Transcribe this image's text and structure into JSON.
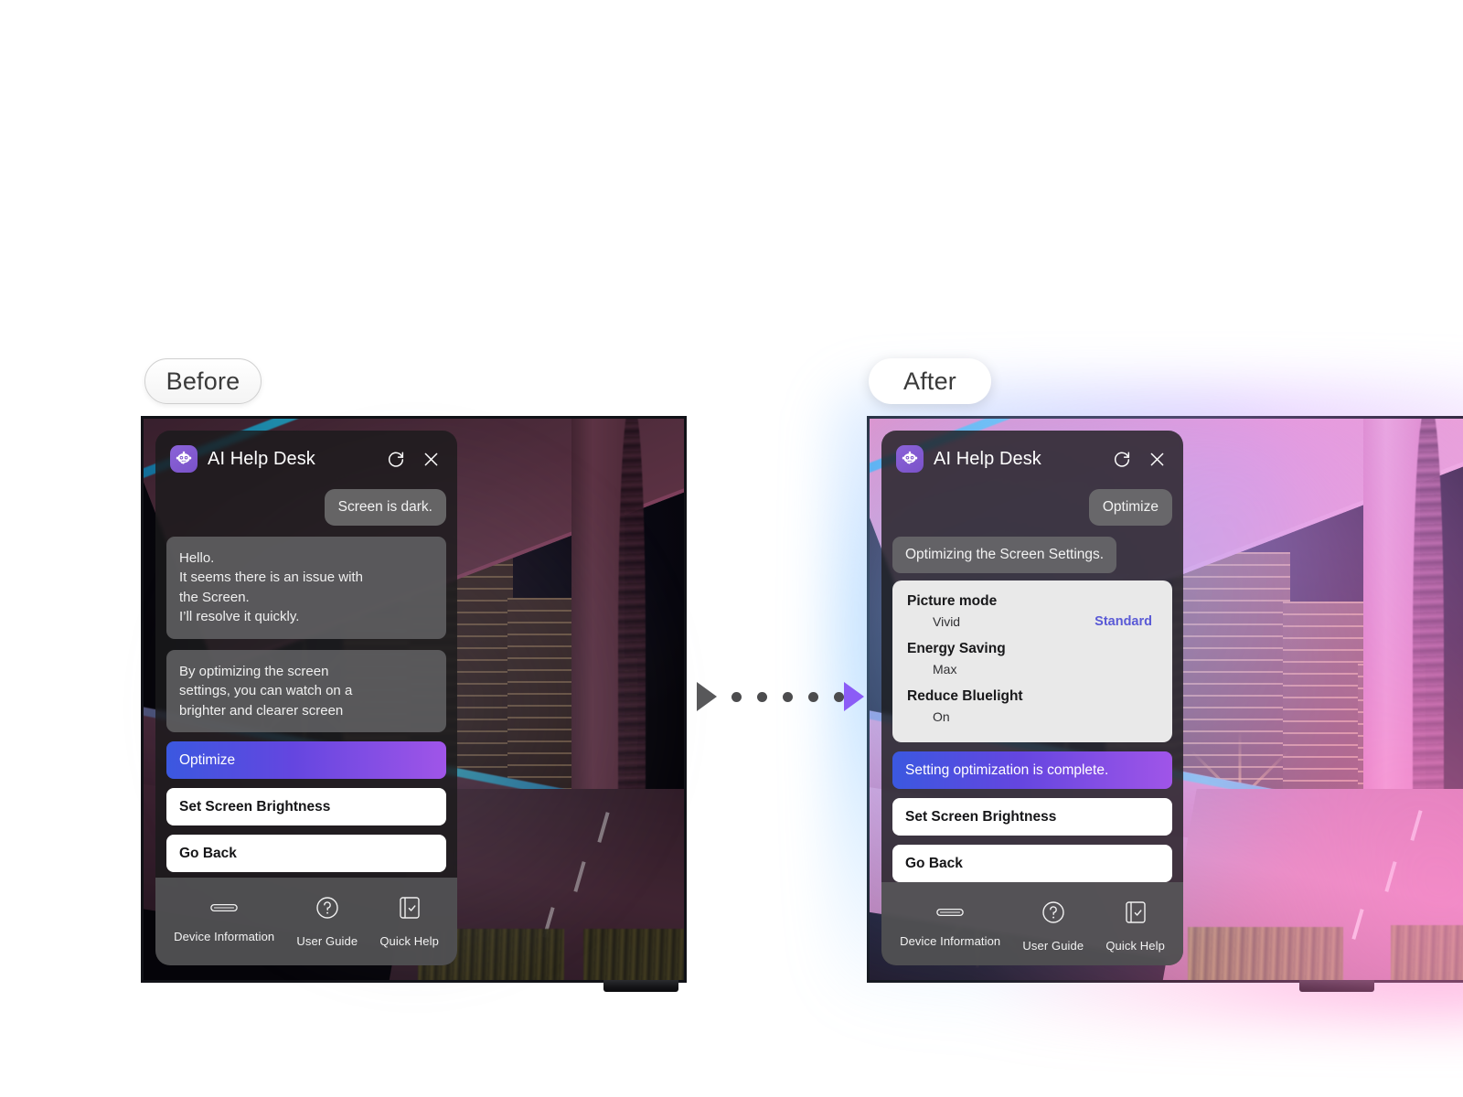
{
  "labels": {
    "before": "Before",
    "after": "After"
  },
  "panel": {
    "title": "AI Help Desk",
    "icons": {
      "bot": "robot-icon",
      "refresh": "refresh-icon",
      "close": "close-icon"
    },
    "footer": {
      "items": [
        {
          "label": "Device Information",
          "icon": "remote-control-icon"
        },
        {
          "label": "User Guide",
          "icon": "question-circle-icon"
        },
        {
          "label": "Quick Help",
          "icon": "checklist-book-icon"
        }
      ]
    }
  },
  "before": {
    "user_message": "Screen is dark.",
    "bot_message_1": "Hello.\nIt seems there is an issue with\nthe Screen.\nI’ll resolve it quickly.",
    "bot_message_2": "By optimizing the screen\nsettings, you can watch on a\nbrighter and clearer screen",
    "buttons": {
      "primary": "Optimize",
      "secondary": "Set Screen Brightness",
      "tertiary": "Go Back"
    }
  },
  "after": {
    "user_message": "Optimize",
    "status_message": "Optimizing the Screen Settings.",
    "settings": [
      {
        "name": "Picture mode",
        "from": "Vivid",
        "to": "Standard"
      },
      {
        "name": "Energy Saving",
        "from": "Max",
        "to": ""
      },
      {
        "name": "Reduce Bluelight",
        "from": "On",
        "to": ""
      }
    ],
    "buttons": {
      "primary": "Setting optimization is complete.",
      "secondary": "Set Screen Brightness",
      "tertiary": "Go Back"
    }
  },
  "colors": {
    "accent_purple": "#8b5cf6",
    "accent_blue": "#3b58e0",
    "setting_highlight": "#5a5ad6",
    "panel_bg": "#1a1a1c",
    "card_bg": "#e9e9e9"
  }
}
